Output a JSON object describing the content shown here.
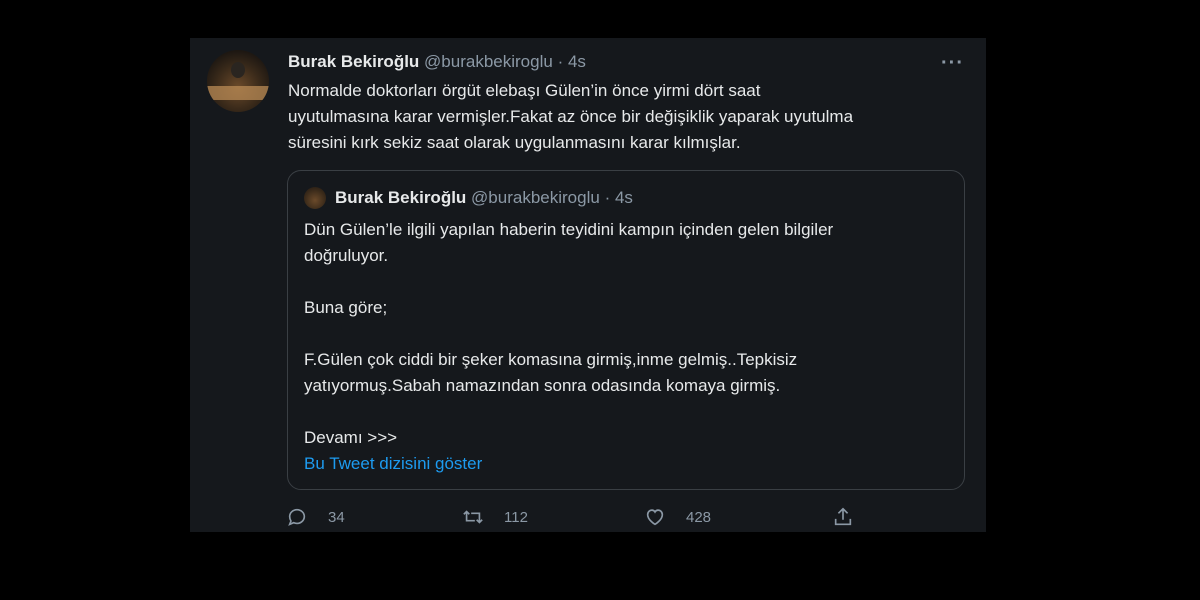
{
  "tweet": {
    "name": "Burak Bekiroğlu",
    "handle": "@burakbekiroglu",
    "time": "· 4s",
    "more_icon": "more-icon",
    "text_lines": [
      "Normalde doktorları örgüt elebaşı Gülen’in önce yirmi dört saat",
      "uyutulmasına karar vermişler.Fakat az önce bir değişiklik yaparak uyutulma",
      "süresini kırk sekiz saat olarak uygulanmasını karar kılmışlar."
    ]
  },
  "quoted": {
    "name": "Burak Bekiroğlu",
    "handle": "@burakbekiroglu",
    "time": "· 4s",
    "para1_line1": "Dün Gülen’le ilgili yapılan haberin teyidini kampın içinden gelen bilgiler",
    "para1_line2": "doğruluyor.",
    "para2": "Buna göre;",
    "para3_line1": "F.Gülen çok ciddi bir şeker komasına girmiş,inme gelmiş..Tepkisiz",
    "para3_line2": "yatıyormuş.Sabah namazından sonra odasında komaya girmiş.",
    "para4": "Devamı >>>",
    "link": "Bu Tweet dizisini göster"
  },
  "actions": {
    "reply_count": "34",
    "retweet_count": "112",
    "like_count": "428"
  },
  "colors": {
    "link": "#1d9bf0",
    "card_bg": "#15181c",
    "muted": "#8b98a5"
  }
}
